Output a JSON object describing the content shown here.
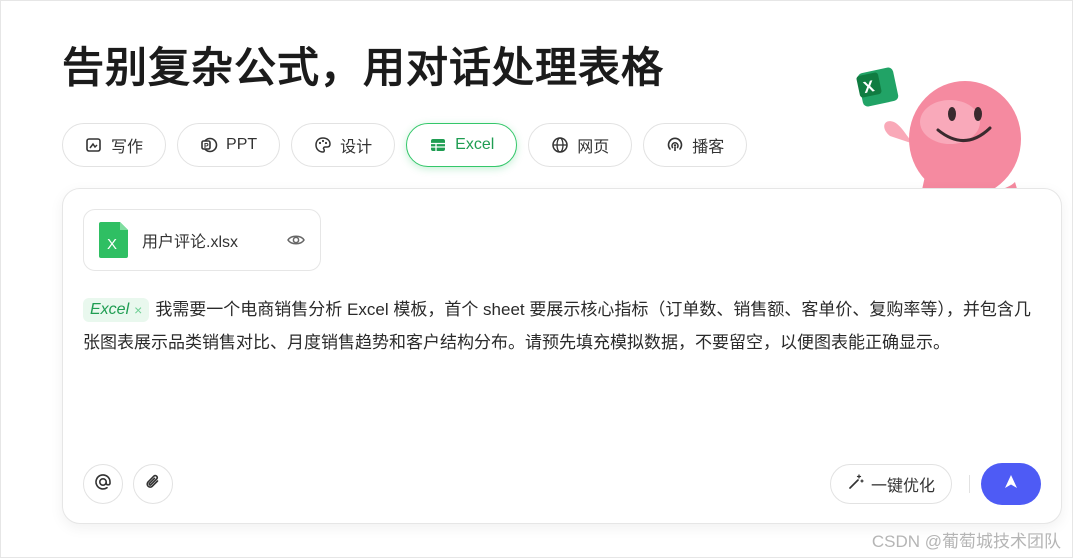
{
  "headline": "告别复杂公式，用对话处理表格",
  "tabs": [
    {
      "label": "写作",
      "icon": "pen-image-icon",
      "active": false
    },
    {
      "label": "PPT",
      "icon": "ppt-icon",
      "active": false
    },
    {
      "label": "设计",
      "icon": "palette-icon",
      "active": false
    },
    {
      "label": "Excel",
      "icon": "table-icon",
      "active": true
    },
    {
      "label": "网页",
      "icon": "globe-icon",
      "active": false
    },
    {
      "label": "播客",
      "icon": "podcast-icon",
      "active": false
    }
  ],
  "attachment": {
    "file_name": "用户评论.xlsx",
    "icon": "excel-file-icon",
    "action_icon": "eye-icon"
  },
  "prompt": {
    "chip_label": "Excel",
    "chip_remove": "×",
    "text": "我需要一个电商销售分析 Excel 模板，首个 sheet 要展示核心指标（订单数、销售额、客单价、复购率等），并包含几张图表展示品类销售对比、月度销售趋势和客户结构分布。请预先填充模拟数据，不要留空，以便图表能正确显示。"
  },
  "toolbar": {
    "mention_icon": "at-icon",
    "attach_icon": "paperclip-icon",
    "optimize_label": "一键优化",
    "optimize_icon": "magic-wand-icon",
    "send_icon": "send-arrow-icon"
  },
  "colors": {
    "accent_green": "#1f9d52",
    "send_blue": "#4e5bf5",
    "mascot_pink": "#f58aa0"
  },
  "watermark": "CSDN @葡萄城技术团队"
}
